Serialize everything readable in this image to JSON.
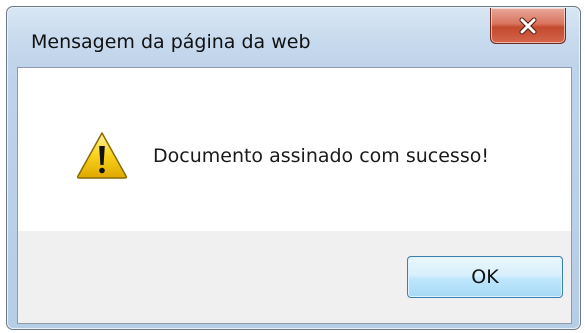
{
  "dialog": {
    "title": "Mensagem da página da web",
    "message": "Documento assinado com sucesso!",
    "icon": "warning-icon",
    "ok_label": "OK",
    "close_icon": "close-icon"
  },
  "colors": {
    "close_button": "#c44a2e",
    "ok_button_border": "#3c7fb1",
    "warning_yellow": "#f5c400"
  }
}
